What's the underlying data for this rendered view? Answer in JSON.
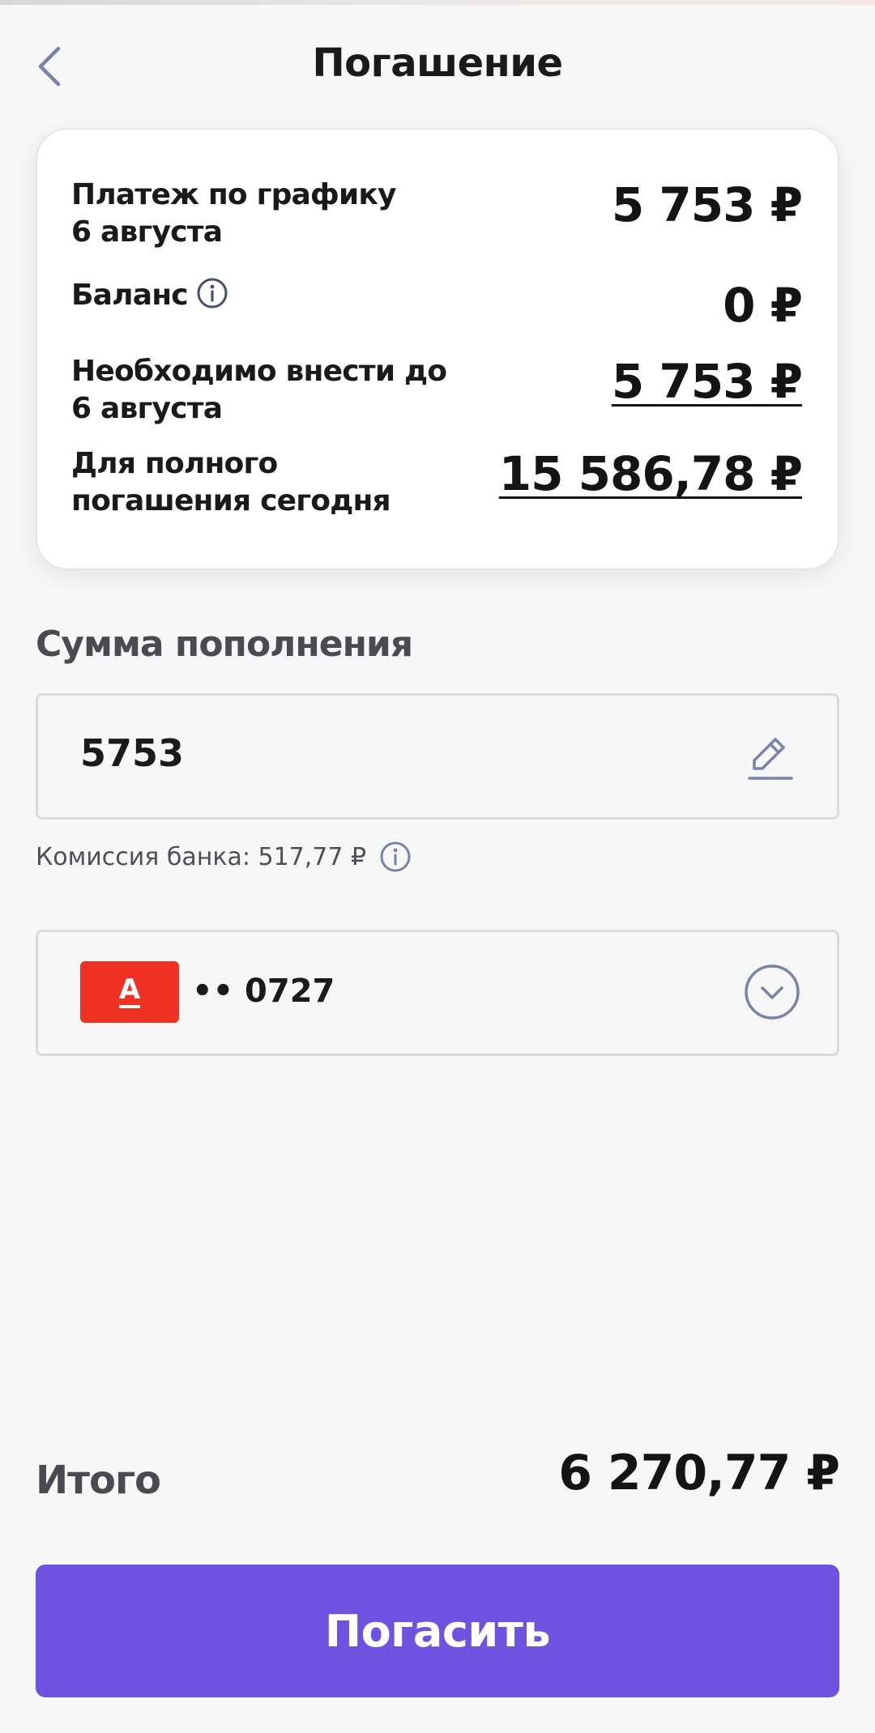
{
  "header": {
    "title": "Погашение"
  },
  "summary": {
    "scheduled_payment": {
      "label_line1": "Платеж по графику",
      "label_line2": "6 августа",
      "value": "5 753 ₽"
    },
    "balance": {
      "label": "Баланс",
      "value": "0 ₽"
    },
    "required": {
      "label_line1": "Необходимо внести до",
      "label_line2": "6 августа",
      "value": "5 753 ₽"
    },
    "full_repayment": {
      "label_line1": "Для полного",
      "label_line2": "погашения сегодня",
      "value": "15 586,78 ₽"
    }
  },
  "topup": {
    "section_title": "Сумма пополнения",
    "amount": "5753",
    "commission": "Комиссия банка: 517,77 ₽"
  },
  "payment_card": {
    "bank_letter": "А",
    "masked_number": "•• 0727"
  },
  "total": {
    "label": "Итого",
    "value": "6 270,77 ₽"
  },
  "pay_button": {
    "label": "Погасить"
  },
  "colors": {
    "accent": "#6e53e0",
    "bank_red": "#ef3124",
    "icon_gray": "#7a7f96"
  }
}
